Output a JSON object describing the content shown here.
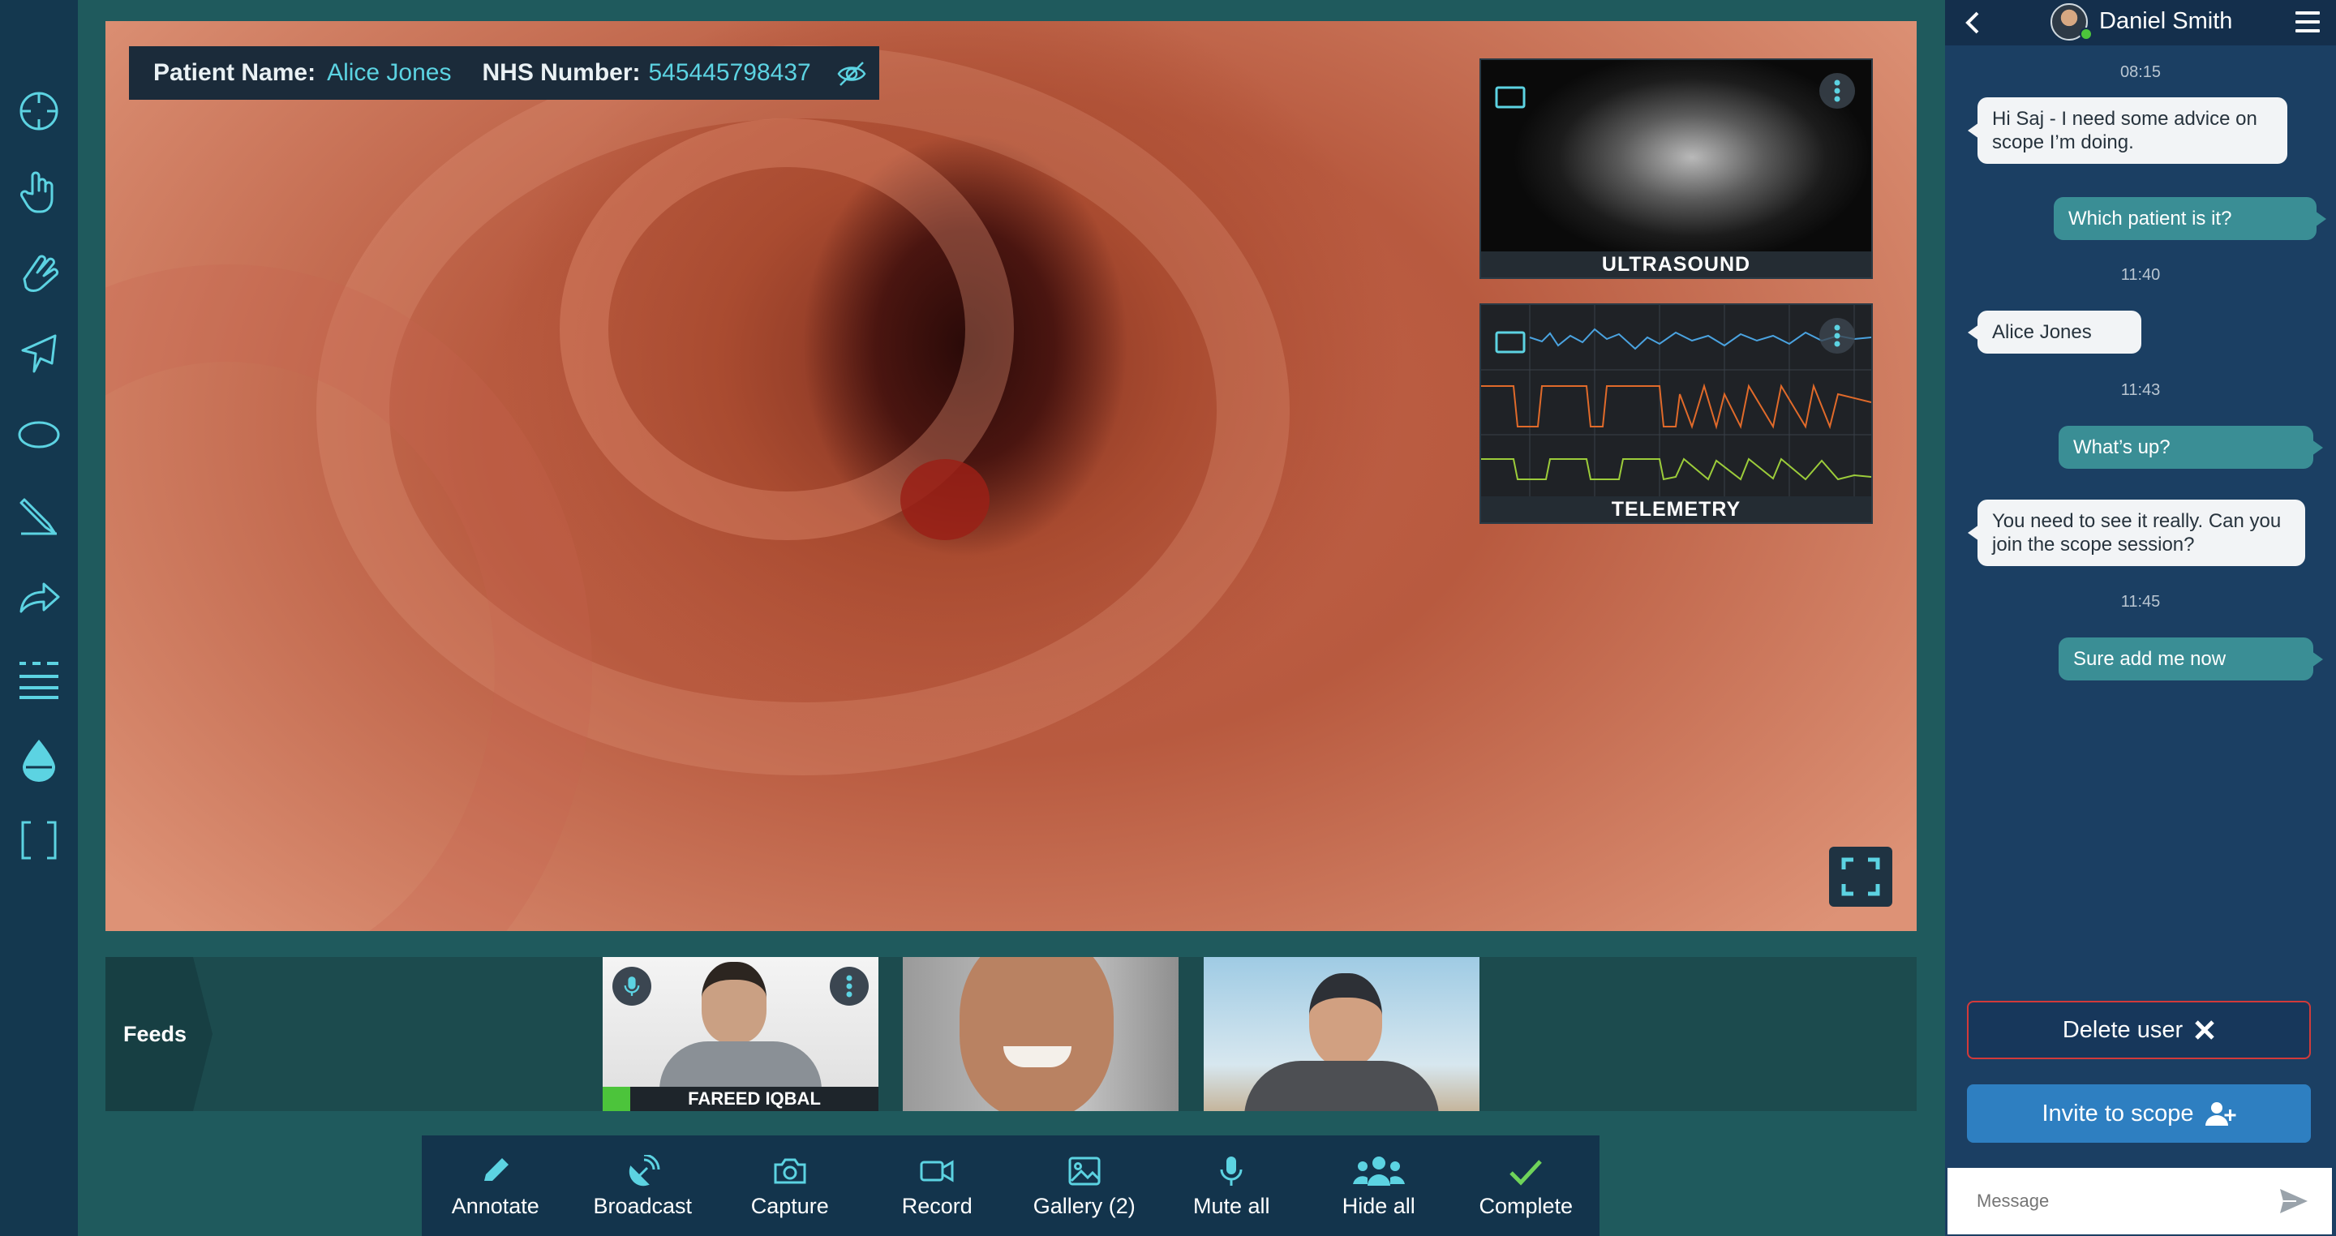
{
  "toolbar_left": {
    "tools": [
      {
        "name": "crosshair-icon"
      },
      {
        "name": "hand-point-icon"
      },
      {
        "name": "hand-drag-icon"
      },
      {
        "name": "pointer-icon"
      },
      {
        "name": "ellipse-icon"
      },
      {
        "name": "pencil-icon"
      },
      {
        "name": "redo-arrow-icon"
      },
      {
        "name": "lines-icon"
      },
      {
        "name": "drop-icon"
      },
      {
        "name": "bracket-icon"
      }
    ]
  },
  "patient": {
    "name_label": "Patient Name:",
    "name_value": "Alice Jones",
    "nhs_label": "NHS Number:",
    "nhs_value": "545445798437"
  },
  "overlays": {
    "ultrasound_label": "ULTRASOUND",
    "telemetry_label": "TELEMETRY"
  },
  "feeds": {
    "title": "Feeds",
    "participants": [
      {
        "name": "FAREED IQBAL"
      }
    ]
  },
  "actions": [
    {
      "label": "Annotate",
      "icon": "pencil-icon"
    },
    {
      "label": "Broadcast",
      "icon": "satellite-icon"
    },
    {
      "label": "Capture",
      "icon": "camera-icon"
    },
    {
      "label": "Record",
      "icon": "video-icon"
    },
    {
      "label": "Gallery (2)",
      "icon": "image-icon"
    },
    {
      "label": "Mute all",
      "icon": "microphone-icon"
    },
    {
      "label": "Hide all",
      "icon": "users-icon"
    },
    {
      "label": "Complete",
      "icon": "check-icon"
    }
  ],
  "chat": {
    "contact_name": "Daniel Smith",
    "messages": [
      {
        "time": "08:15"
      },
      {
        "dir": "in",
        "text": "Hi Saj - I need some advice on scope I’m doing."
      },
      {
        "dir": "out",
        "text": "Which patient is it?"
      },
      {
        "time": "11:40"
      },
      {
        "dir": "in",
        "text": "Alice Jones"
      },
      {
        "time": "11:43"
      },
      {
        "dir": "out",
        "text": "What’s up?"
      },
      {
        "dir": "in",
        "text": "You need to see it really.  Can you join the scope session?"
      },
      {
        "time": "11:45"
      },
      {
        "dir": "out",
        "text": "Sure add me now"
      }
    ],
    "delete_label": "Delete user",
    "invite_label": "Invite to scope",
    "message_placeholder": "Message"
  },
  "colors": {
    "accent": "#5cd3e2",
    "sidebar": "#14384f",
    "background": "#1f5a5d",
    "chat_bg": "#1b3f63",
    "bubble_out": "#3a8e95",
    "delete_border": "#d23a3a",
    "invite_bg": "#2e7fc1",
    "online": "#4cc43b"
  }
}
